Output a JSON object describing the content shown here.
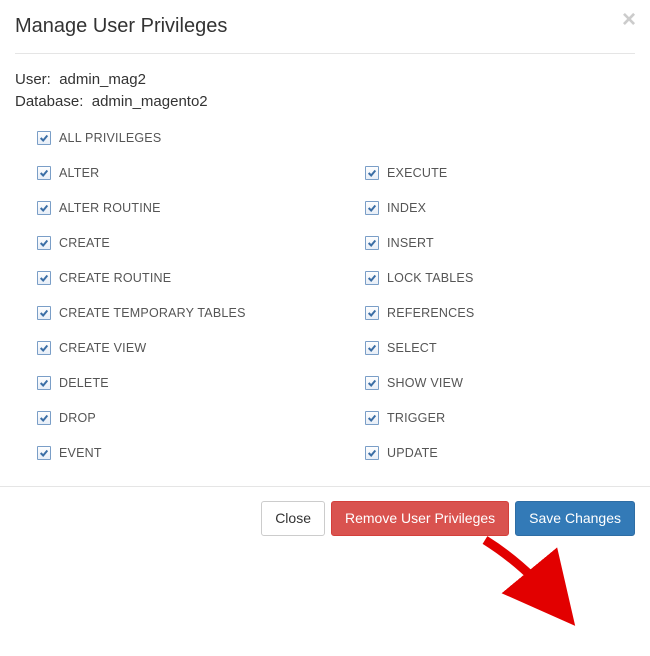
{
  "header": {
    "title": "Manage User Privileges"
  },
  "info": {
    "user_label": "User:",
    "user_value": "admin_mag2",
    "db_label": "Database:",
    "db_value": "admin_magento2"
  },
  "privileges": {
    "all": "ALL PRIVILEGES",
    "left": [
      "ALTER",
      "ALTER ROUTINE",
      "CREATE",
      "CREATE ROUTINE",
      "CREATE TEMPORARY TABLES",
      "CREATE VIEW",
      "DELETE",
      "DROP",
      "EVENT"
    ],
    "right": [
      "EXECUTE",
      "INDEX",
      "INSERT",
      "LOCK TABLES",
      "REFERENCES",
      "SELECT",
      "SHOW VIEW",
      "TRIGGER",
      "UPDATE"
    ]
  },
  "footer": {
    "close": "Close",
    "remove": "Remove User Privileges",
    "save": "Save Changes"
  }
}
